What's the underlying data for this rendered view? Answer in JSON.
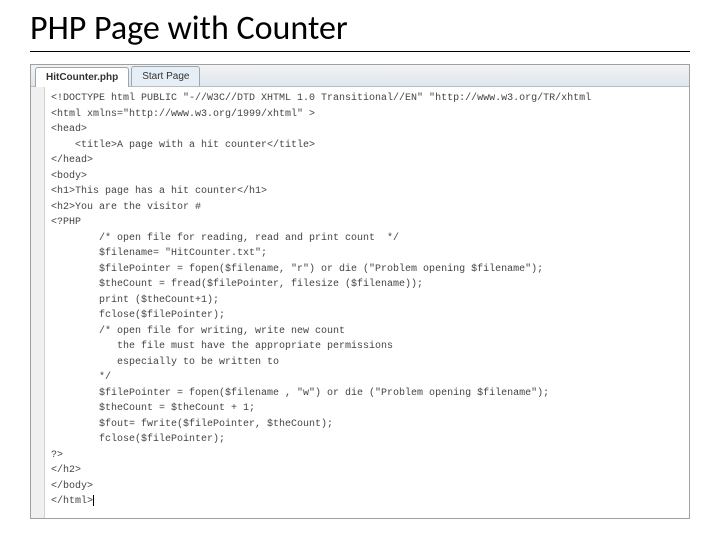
{
  "title": "PHP Page with Counter",
  "tabs": {
    "active": "HitCounter.php",
    "inactive": "Start Page"
  },
  "code": [
    "<!DOCTYPE html PUBLIC \"-//W3C//DTD XHTML 1.0 Transitional//EN\" \"http://www.w3.org/TR/xhtml",
    "<html xmlns=\"http://www.w3.org/1999/xhtml\" >",
    "<head>",
    "    <title>A page with a hit counter</title>",
    "</head>",
    "<body>",
    "<h1>This page has a hit counter</h1>",
    "<h2>You are the visitor #",
    "<?PHP",
    "        /* open file for reading, read and print count  */",
    "        $filename= \"HitCounter.txt\";",
    "        $filePointer = fopen($filename, \"r\") or die (\"Problem opening $filename\");",
    "        $theCount = fread($filePointer, filesize ($filename));",
    "        print ($theCount+1);",
    "        fclose($filePointer);",
    "",
    "        /* open file for writing, write new count",
    "           the file must have the appropriate permissions",
    "           especially to be written to",
    "        */",
    "        $filePointer = fopen($filename , \"w\") or die (\"Problem opening $filename\");",
    "        $theCount = $theCount + 1;",
    "        $fout= fwrite($filePointer, $theCount);",
    "        fclose($filePointer);",
    "",
    "?>",
    "</h2>",
    "</body>",
    "</html>"
  ]
}
